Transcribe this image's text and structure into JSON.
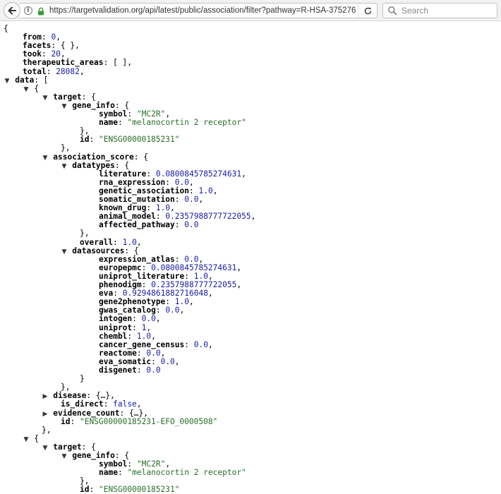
{
  "browser": {
    "url": "https://targetvalidation.org/api/latest/public/association/filter?pathway=R-HSA-375276",
    "search_placeholder": "Search"
  },
  "json_lines": [
    {
      "indent": 0,
      "toggle": "",
      "parts": [
        {
          "t": "p",
          "v": "{"
        }
      ]
    },
    {
      "indent": 4,
      "toggle": "",
      "parts": [
        {
          "t": "k",
          "v": "from"
        },
        {
          "t": "p",
          "v": ": "
        },
        {
          "t": "n",
          "v": "0"
        },
        {
          "t": "p",
          "v": ","
        }
      ]
    },
    {
      "indent": 4,
      "toggle": "",
      "parts": [
        {
          "t": "k",
          "v": "facets"
        },
        {
          "t": "p",
          "v": ": { },"
        }
      ]
    },
    {
      "indent": 4,
      "toggle": "",
      "parts": [
        {
          "t": "k",
          "v": "took"
        },
        {
          "t": "p",
          "v": ": "
        },
        {
          "t": "n",
          "v": "20"
        },
        {
          "t": "p",
          "v": ","
        }
      ]
    },
    {
      "indent": 4,
      "toggle": "",
      "parts": [
        {
          "t": "k",
          "v": "therapeutic_areas"
        },
        {
          "t": "p",
          "v": ": [ ],"
        }
      ]
    },
    {
      "indent": 4,
      "toggle": "",
      "parts": [
        {
          "t": "k",
          "v": "total"
        },
        {
          "t": "p",
          "v": ": "
        },
        {
          "t": "n",
          "v": "28082"
        },
        {
          "t": "p",
          "v": ","
        }
      ]
    },
    {
      "indent": 2,
      "toggle": "▼",
      "parts": [
        {
          "t": "k",
          "v": "data"
        },
        {
          "t": "p",
          "v": ": ["
        }
      ]
    },
    {
      "indent": 6,
      "toggle": "▼",
      "parts": [
        {
          "t": "p",
          "v": "{"
        }
      ]
    },
    {
      "indent": 10,
      "toggle": "▼",
      "parts": [
        {
          "t": "k",
          "v": "target"
        },
        {
          "t": "p",
          "v": ": {"
        }
      ]
    },
    {
      "indent": 14,
      "toggle": "▼",
      "parts": [
        {
          "t": "k",
          "v": "gene_info"
        },
        {
          "t": "p",
          "v": ": {"
        }
      ]
    },
    {
      "indent": 20,
      "toggle": "",
      "parts": [
        {
          "t": "k",
          "v": "symbol"
        },
        {
          "t": "p",
          "v": ": "
        },
        {
          "t": "s",
          "v": "\"MC2R\""
        },
        {
          "t": "p",
          "v": ","
        }
      ]
    },
    {
      "indent": 20,
      "toggle": "",
      "parts": [
        {
          "t": "k",
          "v": "name"
        },
        {
          "t": "p",
          "v": ": "
        },
        {
          "t": "s",
          "v": "\"melanocortin 2 receptor\""
        }
      ]
    },
    {
      "indent": 16,
      "toggle": "",
      "parts": [
        {
          "t": "p",
          "v": "},"
        }
      ]
    },
    {
      "indent": 16,
      "toggle": "",
      "parts": [
        {
          "t": "k",
          "v": "id"
        },
        {
          "t": "p",
          "v": ": "
        },
        {
          "t": "s",
          "v": "\"ENSG00000185231\""
        }
      ]
    },
    {
      "indent": 12,
      "toggle": "",
      "parts": [
        {
          "t": "p",
          "v": "},"
        }
      ]
    },
    {
      "indent": 10,
      "toggle": "▼",
      "parts": [
        {
          "t": "k",
          "v": "association_score"
        },
        {
          "t": "p",
          "v": ": {"
        }
      ]
    },
    {
      "indent": 14,
      "toggle": "▼",
      "parts": [
        {
          "t": "k",
          "v": "datatypes"
        },
        {
          "t": "p",
          "v": ": {"
        }
      ]
    },
    {
      "indent": 20,
      "toggle": "",
      "parts": [
        {
          "t": "k",
          "v": "literature"
        },
        {
          "t": "p",
          "v": ": "
        },
        {
          "t": "n",
          "v": "0.0800845785274631"
        },
        {
          "t": "p",
          "v": ","
        }
      ]
    },
    {
      "indent": 20,
      "toggle": "",
      "parts": [
        {
          "t": "k",
          "v": "rna_expression"
        },
        {
          "t": "p",
          "v": ": "
        },
        {
          "t": "n",
          "v": "0.0"
        },
        {
          "t": "p",
          "v": ","
        }
      ]
    },
    {
      "indent": 20,
      "toggle": "",
      "parts": [
        {
          "t": "k",
          "v": "genetic_association"
        },
        {
          "t": "p",
          "v": ": "
        },
        {
          "t": "n",
          "v": "1.0"
        },
        {
          "t": "p",
          "v": ","
        }
      ]
    },
    {
      "indent": 20,
      "toggle": "",
      "parts": [
        {
          "t": "k",
          "v": "somatic_mutation"
        },
        {
          "t": "p",
          "v": ": "
        },
        {
          "t": "n",
          "v": "0.0"
        },
        {
          "t": "p",
          "v": ","
        }
      ]
    },
    {
      "indent": 20,
      "toggle": "",
      "parts": [
        {
          "t": "k",
          "v": "known_drug"
        },
        {
          "t": "p",
          "v": ": "
        },
        {
          "t": "n",
          "v": "1.0"
        },
        {
          "t": "p",
          "v": ","
        }
      ]
    },
    {
      "indent": 20,
      "toggle": "",
      "parts": [
        {
          "t": "k",
          "v": "animal_model"
        },
        {
          "t": "p",
          "v": ": "
        },
        {
          "t": "n",
          "v": "0.2357988777722055"
        },
        {
          "t": "p",
          "v": ","
        }
      ]
    },
    {
      "indent": 20,
      "toggle": "",
      "parts": [
        {
          "t": "k",
          "v": "affected_pathway"
        },
        {
          "t": "p",
          "v": ": "
        },
        {
          "t": "n",
          "v": "0.0"
        }
      ]
    },
    {
      "indent": 16,
      "toggle": "",
      "parts": [
        {
          "t": "p",
          "v": "},"
        }
      ]
    },
    {
      "indent": 16,
      "toggle": "",
      "parts": [
        {
          "t": "k",
          "v": "overall"
        },
        {
          "t": "p",
          "v": ": "
        },
        {
          "t": "n",
          "v": "1.0"
        },
        {
          "t": "p",
          "v": ","
        }
      ]
    },
    {
      "indent": 14,
      "toggle": "▼",
      "parts": [
        {
          "t": "k",
          "v": "datasources"
        },
        {
          "t": "p",
          "v": ": {"
        }
      ]
    },
    {
      "indent": 20,
      "toggle": "",
      "parts": [
        {
          "t": "k",
          "v": "expression_atlas"
        },
        {
          "t": "p",
          "v": ": "
        },
        {
          "t": "n",
          "v": "0.0"
        },
        {
          "t": "p",
          "v": ","
        }
      ]
    },
    {
      "indent": 20,
      "toggle": "",
      "parts": [
        {
          "t": "k",
          "v": "europepmc"
        },
        {
          "t": "p",
          "v": ": "
        },
        {
          "t": "n",
          "v": "0.0800845785274631"
        },
        {
          "t": "p",
          "v": ","
        }
      ]
    },
    {
      "indent": 20,
      "toggle": "",
      "parts": [
        {
          "t": "k",
          "v": "uniprot_literature"
        },
        {
          "t": "p",
          "v": ": "
        },
        {
          "t": "n",
          "v": "1.0"
        },
        {
          "t": "p",
          "v": ","
        }
      ]
    },
    {
      "indent": 20,
      "toggle": "",
      "parts": [
        {
          "t": "k",
          "v": "phenodigm"
        },
        {
          "t": "p",
          "v": ": "
        },
        {
          "t": "n",
          "v": "0.2357988777722055"
        },
        {
          "t": "p",
          "v": ","
        }
      ]
    },
    {
      "indent": 20,
      "toggle": "",
      "parts": [
        {
          "t": "k",
          "v": "eva"
        },
        {
          "t": "p",
          "v": ": "
        },
        {
          "t": "n",
          "v": "0.9294861882716048"
        },
        {
          "t": "p",
          "v": ","
        }
      ]
    },
    {
      "indent": 20,
      "toggle": "",
      "parts": [
        {
          "t": "k",
          "v": "gene2phenotype"
        },
        {
          "t": "p",
          "v": ": "
        },
        {
          "t": "n",
          "v": "1.0"
        },
        {
          "t": "p",
          "v": ","
        }
      ]
    },
    {
      "indent": 20,
      "toggle": "",
      "parts": [
        {
          "t": "k",
          "v": "gwas_catalog"
        },
        {
          "t": "p",
          "v": ": "
        },
        {
          "t": "n",
          "v": "0.0"
        },
        {
          "t": "p",
          "v": ","
        }
      ]
    },
    {
      "indent": 20,
      "toggle": "",
      "parts": [
        {
          "t": "k",
          "v": "intogen"
        },
        {
          "t": "p",
          "v": ": "
        },
        {
          "t": "n",
          "v": "0.0"
        },
        {
          "t": "p",
          "v": ","
        }
      ]
    },
    {
      "indent": 20,
      "toggle": "",
      "parts": [
        {
          "t": "k",
          "v": "uniprot"
        },
        {
          "t": "p",
          "v": ": "
        },
        {
          "t": "n",
          "v": "1"
        },
        {
          "t": "p",
          "v": ","
        }
      ]
    },
    {
      "indent": 20,
      "toggle": "",
      "parts": [
        {
          "t": "k",
          "v": "chembl"
        },
        {
          "t": "p",
          "v": ": "
        },
        {
          "t": "n",
          "v": "1.0"
        },
        {
          "t": "p",
          "v": ","
        }
      ]
    },
    {
      "indent": 20,
      "toggle": "",
      "parts": [
        {
          "t": "k",
          "v": "cancer_gene_census"
        },
        {
          "t": "p",
          "v": ": "
        },
        {
          "t": "n",
          "v": "0.0"
        },
        {
          "t": "p",
          "v": ","
        }
      ]
    },
    {
      "indent": 20,
      "toggle": "",
      "parts": [
        {
          "t": "k",
          "v": "reactome"
        },
        {
          "t": "p",
          "v": ": "
        },
        {
          "t": "n",
          "v": "0.0"
        },
        {
          "t": "p",
          "v": ","
        }
      ]
    },
    {
      "indent": 20,
      "toggle": "",
      "parts": [
        {
          "t": "k",
          "v": "eva_somatic"
        },
        {
          "t": "p",
          "v": ": "
        },
        {
          "t": "n",
          "v": "0.0"
        },
        {
          "t": "p",
          "v": ","
        }
      ]
    },
    {
      "indent": 20,
      "toggle": "",
      "parts": [
        {
          "t": "k",
          "v": "disgenet"
        },
        {
          "t": "p",
          "v": ": "
        },
        {
          "t": "n",
          "v": "0.0"
        }
      ]
    },
    {
      "indent": 16,
      "toggle": "",
      "parts": [
        {
          "t": "p",
          "v": "}"
        }
      ]
    },
    {
      "indent": 12,
      "toggle": "",
      "parts": [
        {
          "t": "p",
          "v": "},"
        }
      ]
    },
    {
      "indent": 10,
      "toggle": "▶",
      "parts": [
        {
          "t": "k",
          "v": "disease"
        },
        {
          "t": "p",
          "v": ": {…},"
        }
      ]
    },
    {
      "indent": 12,
      "toggle": "",
      "parts": [
        {
          "t": "k",
          "v": "is_direct"
        },
        {
          "t": "p",
          "v": ": "
        },
        {
          "t": "n",
          "v": "false"
        },
        {
          "t": "p",
          "v": ","
        }
      ]
    },
    {
      "indent": 10,
      "toggle": "▶",
      "parts": [
        {
          "t": "k",
          "v": "evidence_count"
        },
        {
          "t": "p",
          "v": ": {…},"
        }
      ]
    },
    {
      "indent": 12,
      "toggle": "",
      "parts": [
        {
          "t": "k",
          "v": "id"
        },
        {
          "t": "p",
          "v": ": "
        },
        {
          "t": "s",
          "v": "\"ENSG00000185231-EFO_0000508\""
        }
      ]
    },
    {
      "indent": 8,
      "toggle": "",
      "parts": [
        {
          "t": "p",
          "v": "},"
        }
      ]
    },
    {
      "indent": 6,
      "toggle": "▼",
      "parts": [
        {
          "t": "p",
          "v": "{"
        }
      ]
    },
    {
      "indent": 10,
      "toggle": "▼",
      "parts": [
        {
          "t": "k",
          "v": "target"
        },
        {
          "t": "p",
          "v": ": {"
        }
      ]
    },
    {
      "indent": 14,
      "toggle": "▼",
      "parts": [
        {
          "t": "k",
          "v": "gene_info"
        },
        {
          "t": "p",
          "v": ": {"
        }
      ]
    },
    {
      "indent": 20,
      "toggle": "",
      "parts": [
        {
          "t": "k",
          "v": "symbol"
        },
        {
          "t": "p",
          "v": ": "
        },
        {
          "t": "s",
          "v": "\"MC2R\""
        },
        {
          "t": "p",
          "v": ","
        }
      ]
    },
    {
      "indent": 20,
      "toggle": "",
      "parts": [
        {
          "t": "k",
          "v": "name"
        },
        {
          "t": "p",
          "v": ": "
        },
        {
          "t": "s",
          "v": "\"melanocortin 2 receptor\""
        }
      ]
    },
    {
      "indent": 16,
      "toggle": "",
      "parts": [
        {
          "t": "p",
          "v": "},"
        }
      ]
    },
    {
      "indent": 16,
      "toggle": "",
      "parts": [
        {
          "t": "k",
          "v": "id"
        },
        {
          "t": "p",
          "v": ": "
        },
        {
          "t": "s",
          "v": "\"ENSG00000185231\""
        }
      ]
    }
  ]
}
